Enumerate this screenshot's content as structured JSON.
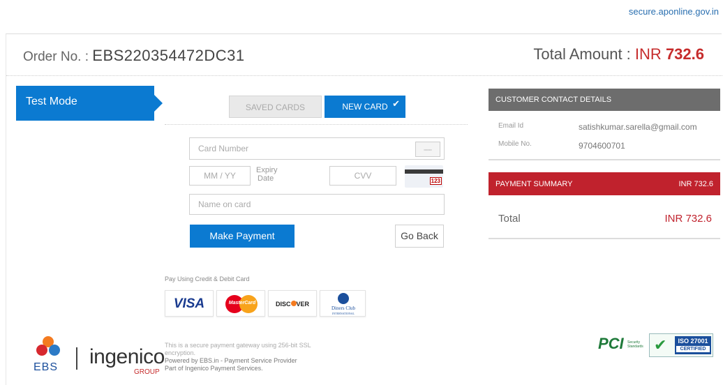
{
  "site_url": "secure.aponline.gov.in",
  "order": {
    "label": "Order No. :",
    "number": "EBS220354472DC31"
  },
  "total": {
    "label": "Total Amount :",
    "currency": "INR",
    "amount": "732.6"
  },
  "mode_banner": "Test Mode",
  "tabs": {
    "saved": "SAVED CARDS",
    "new": "NEW CARD",
    "check_glyph": "✔"
  },
  "form": {
    "card_number_placeholder": "Card Number",
    "expiry_placeholder": "MM / YY",
    "expiry_label_line1": "Expiry",
    "expiry_label_line2": "Date",
    "cvv_placeholder": "CVV",
    "cvv_icon_number": "123",
    "name_placeholder": "Name on card",
    "make_payment_label": "Make Payment",
    "go_back_label": "Go Back"
  },
  "pay_using_label": "Pay Using Credit & Debit Card",
  "brands": {
    "visa": "VISA",
    "mastercard": "MasterCard",
    "discover_pre": "DISC",
    "discover_post": "VER",
    "diners_line1": "Diners Club",
    "diners_line2": "INTERNATIONAL"
  },
  "contact": {
    "heading": "CUSTOMER CONTACT DETAILS",
    "email_label": "Email Id",
    "email_value": "satishkumar.sarella@gmail.com",
    "mobile_label": "Mobile No.",
    "mobile_value": "9704600701"
  },
  "summary": {
    "heading": "PAYMENT SUMMARY",
    "heading_amount": "INR 732.6",
    "total_label": "Total",
    "total_value": "INR 732.6"
  },
  "footer": {
    "line1": "This is a secure payment gateway using 256-bit SSL",
    "line2": "encryption.",
    "line3": "Powered by EBS.in - Payment Service Provider",
    "line4": "Part of Ingenico Payment Services."
  },
  "logos": {
    "ebs": "EBS",
    "ingenico": "ingenico",
    "ingenico_group": "GROUP",
    "pci": "PCI",
    "pci_sub_line1": "Security",
    "pci_sub_line2": "Standards",
    "iso_line1": "ISO 27001",
    "iso_line2": "CERTIFIED"
  },
  "colors": {
    "primary_blue": "#0b7ad1",
    "summary_red": "#c0222d",
    "contact_gray": "#6d6d6d",
    "amount_red": "#c62c2c"
  }
}
